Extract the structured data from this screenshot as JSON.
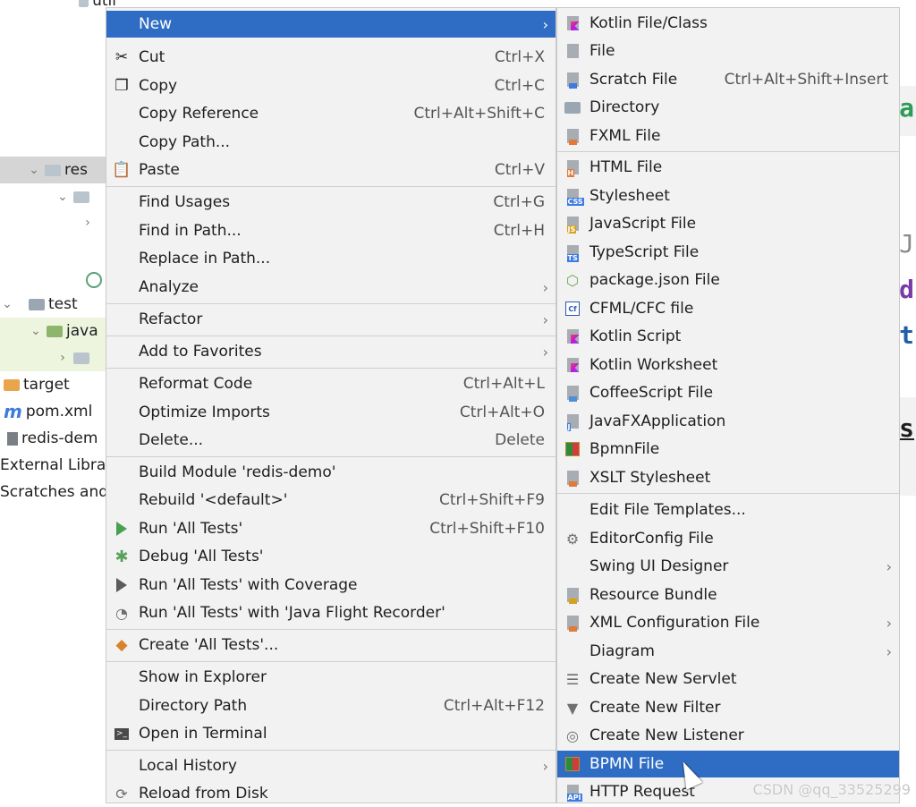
{
  "background_tree": {
    "util": "util",
    "resources": "res",
    "test": "test",
    "java": "java",
    "target": "target",
    "pom": "pom.xml",
    "redis_demo": "redis-dem",
    "external_libraries": "External Libra",
    "scratches": "Scratches and"
  },
  "editor_glimpse": [
    "a",
    "J",
    "d",
    "t",
    "s"
  ],
  "main_menu": {
    "new": "New",
    "cut": {
      "label": "Cut",
      "shortcut": "Ctrl+X"
    },
    "copy": {
      "label": "Copy",
      "shortcut": "Ctrl+C"
    },
    "copy_reference": {
      "label": "Copy Reference",
      "shortcut": "Ctrl+Alt+Shift+C"
    },
    "copy_path": {
      "label": "Copy Path..."
    },
    "paste": {
      "label": "Paste",
      "shortcut": "Ctrl+V"
    },
    "find_usages": {
      "label": "Find Usages",
      "shortcut": "Ctrl+G"
    },
    "find_in_path": {
      "label": "Find in Path...",
      "shortcut": "Ctrl+H"
    },
    "replace_in_path": {
      "label": "Replace in Path..."
    },
    "analyze": {
      "label": "Analyze"
    },
    "refactor": {
      "label": "Refactor"
    },
    "add_to_favorites": {
      "label": "Add to Favorites"
    },
    "reformat_code": {
      "label": "Reformat Code",
      "shortcut": "Ctrl+Alt+L"
    },
    "optimize_imports": {
      "label": "Optimize Imports",
      "shortcut": "Ctrl+Alt+O"
    },
    "delete": {
      "label": "Delete...",
      "shortcut": "Delete"
    },
    "build_module": {
      "label": "Build Module 'redis-demo'"
    },
    "rebuild": {
      "label": "Rebuild '<default>'",
      "shortcut": "Ctrl+Shift+F9"
    },
    "run_tests": {
      "label": "Run 'All Tests'",
      "shortcut": "Ctrl+Shift+F10"
    },
    "debug_tests": {
      "label": "Debug 'All Tests'"
    },
    "run_coverage": {
      "label": "Run 'All Tests' with Coverage"
    },
    "run_jfr": {
      "label": "Run 'All Tests' with 'Java Flight Recorder'"
    },
    "create_tests": {
      "label": "Create 'All Tests'..."
    },
    "show_in_explorer": {
      "label": "Show in Explorer"
    },
    "directory_path": {
      "label": "Directory Path",
      "shortcut": "Ctrl+Alt+F12"
    },
    "open_terminal": {
      "label": "Open in Terminal"
    },
    "local_history": {
      "label": "Local History"
    },
    "reload_disk": {
      "label": "Reload from Disk"
    }
  },
  "new_menu": {
    "kotlin_class": "Kotlin File/Class",
    "file": "File",
    "scratch": {
      "label": "Scratch File",
      "shortcut": "Ctrl+Alt+Shift+Insert"
    },
    "directory": "Directory",
    "fxml": "FXML File",
    "html": "HTML File",
    "stylesheet": "Stylesheet",
    "javascript": "JavaScript File",
    "typescript": "TypeScript File",
    "package_json": "package.json File",
    "cfml": "CFML/CFC file",
    "kotlin_script": "Kotlin Script",
    "kotlin_worksheet": "Kotlin Worksheet",
    "coffeescript": "CoffeeScript File",
    "javafx": "JavaFXApplication",
    "bpmnfile": "BpmnFile",
    "xslt": "XSLT Stylesheet",
    "edit_templates": "Edit File Templates...",
    "editorconfig": "EditorConfig File",
    "swing": "Swing UI Designer",
    "resource_bundle": "Resource Bundle",
    "xml_config": "XML Configuration File",
    "diagram": "Diagram",
    "servlet": "Create New Servlet",
    "filter": "Create New Filter",
    "listener": "Create New Listener",
    "bpmn_file": "BPMN File",
    "http_request": "HTTP Request"
  },
  "icon_labels": {
    "css": "CSS",
    "js": "JS",
    "ts": "TS",
    "h": "H",
    "cf": "Cf",
    "api": "API",
    "j": "J"
  },
  "watermark": "CSDN @qq_33525299",
  "colors": {
    "selection": "#2f6dc4",
    "menu_bg": "#f2f2f2"
  }
}
